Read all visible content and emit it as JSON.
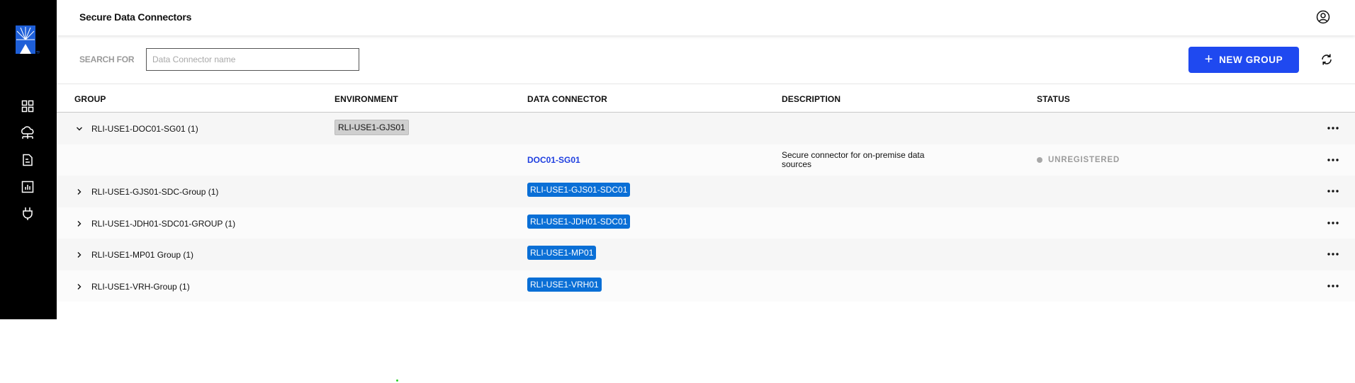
{
  "app": {
    "title": "Secure Data Connectors"
  },
  "sidebar": {
    "logo": "brand-logo",
    "items": [
      {
        "icon": "dashboard-icon"
      },
      {
        "icon": "cloud-network-icon"
      },
      {
        "icon": "document-icon"
      },
      {
        "icon": "report-chart-icon"
      },
      {
        "icon": "plug-icon"
      }
    ]
  },
  "header": {
    "user_icon": "user-account-icon"
  },
  "toolbar": {
    "search_label": "SEARCH FOR",
    "search_placeholder": "Data Connector name",
    "search_value": "",
    "new_group_label": "NEW GROUP",
    "refresh_icon": "refresh-icon"
  },
  "table": {
    "columns": [
      "GROUP",
      "ENVIRONMENT",
      "DATA CONNECTOR",
      "DESCRIPTION",
      "STATUS"
    ],
    "rows": [
      {
        "expanded": true,
        "group": "RLI-USE1-DOC01-SG01 (1)",
        "environment": "RLI-USE1-GJS01",
        "connector": "",
        "description": "",
        "status": ""
      },
      {
        "expanded": null,
        "group": "",
        "environment": "",
        "connector_link": "DOC01-SG01",
        "description": "Secure connector for on-premise data sources",
        "status": "UNREGISTERED"
      },
      {
        "expanded": false,
        "group": "RLI-USE1-GJS01-SDC-Group (1)",
        "environment": "",
        "connector": "RLI-USE1-GJS01-SDC01",
        "description": "",
        "status": ""
      },
      {
        "expanded": false,
        "group": "RLI-USE1-JDH01-SDC01-GROUP (1)",
        "environment": "",
        "connector": "RLI-USE1-JDH01-SDC01",
        "description": "",
        "status": ""
      },
      {
        "expanded": false,
        "group": "RLI-USE1-MP01 Group (1)",
        "environment": "",
        "connector": "RLI-USE1-MP01",
        "description": "",
        "status": ""
      },
      {
        "expanded": false,
        "group": "RLI-USE1-VRH-Group (1)",
        "environment": "",
        "connector": "RLI-USE1-VRH01",
        "description": "",
        "status": ""
      }
    ]
  },
  "colors": {
    "sidebar_bg": "#000000",
    "primary_button": "#1f49f0",
    "connector_chip": "#0a6fd6",
    "environment_chip": "#cfcfcf",
    "link": "#1f3fe0",
    "status_muted": "#9c9c9c"
  }
}
